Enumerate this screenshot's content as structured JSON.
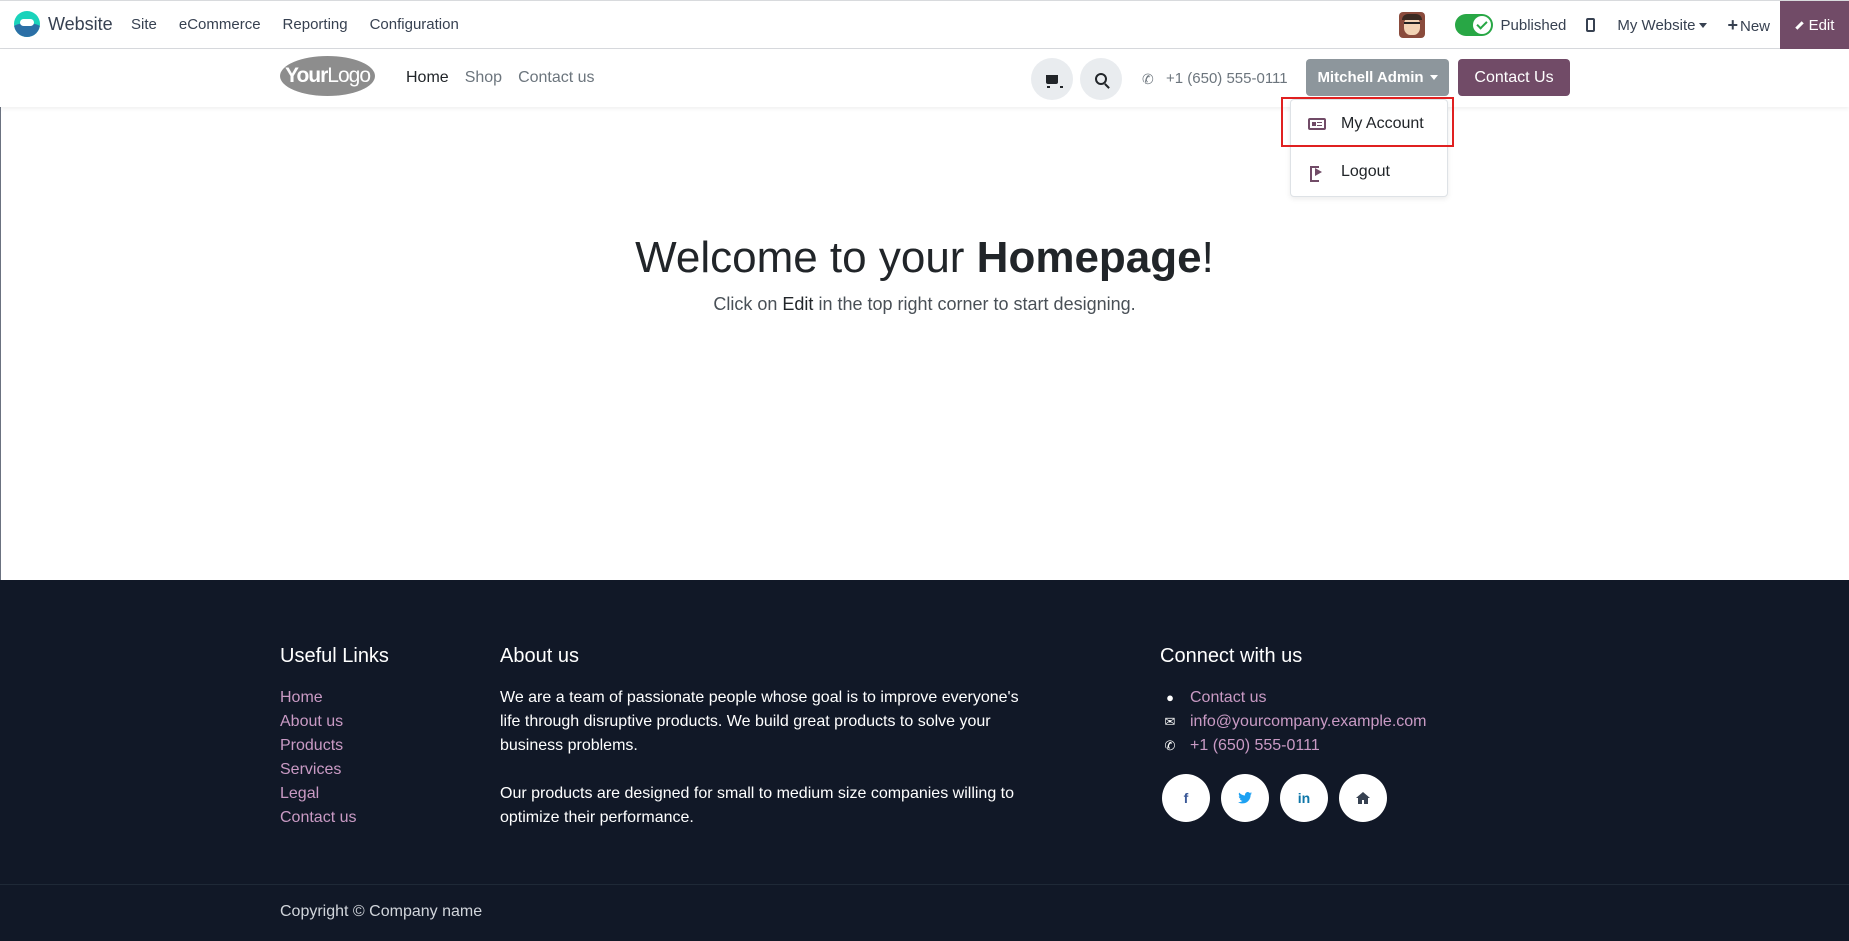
{
  "admin_bar": {
    "app_name": "Website",
    "menu": [
      "Site",
      "eCommerce",
      "Reporting",
      "Configuration"
    ],
    "published_label": "Published",
    "published": true,
    "website_selector": "My Website",
    "new_label": "New",
    "edit_label": "Edit"
  },
  "header": {
    "logo_bold": "Your",
    "logo_light": "Logo",
    "nav": [
      "Home",
      "Shop",
      "Contact us"
    ],
    "phone": "+1 (650) 555-0111",
    "user_name": "Mitchell Admin",
    "cta_label": "Contact Us"
  },
  "user_menu": {
    "items": [
      "My Account",
      "Logout"
    ]
  },
  "hero": {
    "title_prefix": "Welcome to your ",
    "title_bold": "Homepage",
    "title_suffix": "!",
    "sub_prefix": "Click on ",
    "sub_bold": "Edit",
    "sub_suffix": " in the top right corner to start designing."
  },
  "footer": {
    "useful_links_title": "Useful Links",
    "useful_links": [
      "Home",
      "About us",
      "Products",
      "Services",
      "Legal",
      "Contact us"
    ],
    "about_title": "About us",
    "about_p1": "We are a team of passionate people whose goal is to improve everyone's life through disruptive products. We build great products to solve your business problems.",
    "about_p2": "Our products are designed for small to medium size companies willing to optimize their performance.",
    "connect_title": "Connect with us",
    "connect_contact": "Contact us",
    "connect_email": "info@yourcompany.example.com",
    "connect_phone": "+1 (650) 555-0111",
    "socials": [
      "facebook-icon",
      "twitter-icon",
      "linkedin-icon",
      "home-icon"
    ],
    "copyright": "Copyright © Company name"
  },
  "colors": {
    "brand": "#714b67",
    "footer_bg": "#111827",
    "link": "#c99ac4",
    "highlight": "#e02020"
  }
}
